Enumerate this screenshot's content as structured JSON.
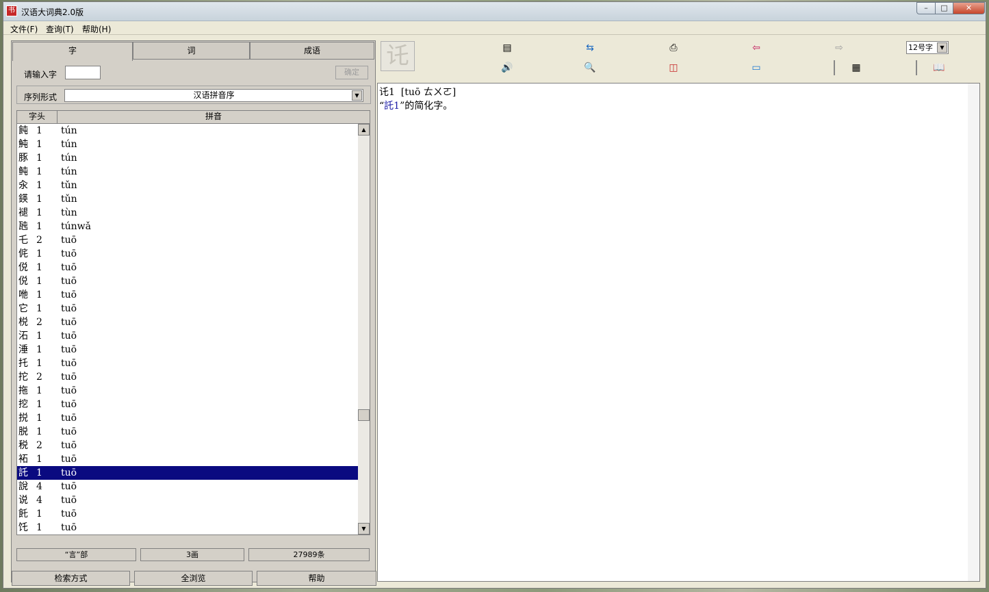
{
  "window": {
    "title": "汉语大词典2.0版",
    "app_icon": "书"
  },
  "window_buttons": {
    "minimize": "–",
    "maximize": "□",
    "close": "✕"
  },
  "menu": {
    "file": "文件(F)",
    "query": "查询(T)",
    "help": "帮助(H)"
  },
  "tabs": {
    "char": "字",
    "word": "词",
    "idiom": "成语"
  },
  "input": {
    "label": "请输入字",
    "value": "",
    "confirm": "确定"
  },
  "order": {
    "label": "序列形式",
    "value": "汉语拼音序",
    "arrow": "▼"
  },
  "list": {
    "headers": {
      "char": "字头",
      "pinyin": "拼音"
    },
    "rows": [
      {
        "c": "飩",
        "n": "1",
        "p": "tún"
      },
      {
        "c": "魨",
        "n": "1",
        "p": "tún"
      },
      {
        "c": "豚",
        "n": "1",
        "p": "tún"
      },
      {
        "c": "鲀",
        "n": "1",
        "p": "tún"
      },
      {
        "c": "汆",
        "n": "1",
        "p": "tǔn"
      },
      {
        "c": "鍈",
        "n": "1",
        "p": "tǔn"
      },
      {
        "c": "褪",
        "n": "1",
        "p": "tùn"
      },
      {
        "c": "瓲",
        "n": "1",
        "p": "túnwǎ"
      },
      {
        "c": "乇",
        "n": "2",
        "p": "tuō"
      },
      {
        "c": "侂",
        "n": "1",
        "p": "tuō"
      },
      {
        "c": "侻",
        "n": "1",
        "p": "tuō"
      },
      {
        "c": "侻",
        "n": "1",
        "p": "tuō"
      },
      {
        "c": "咃",
        "n": "1",
        "p": "tuō"
      },
      {
        "c": "它",
        "n": "1",
        "p": "tuō"
      },
      {
        "c": "棁",
        "n": "2",
        "p": "tuō"
      },
      {
        "c": "沰",
        "n": "1",
        "p": "tuō"
      },
      {
        "c": "涶",
        "n": "1",
        "p": "tuō"
      },
      {
        "c": "托",
        "n": "1",
        "p": "tuō"
      },
      {
        "c": "拕",
        "n": "2",
        "p": "tuō"
      },
      {
        "c": "拖",
        "n": "1",
        "p": "tuō"
      },
      {
        "c": "挖",
        "n": "1",
        "p": "tuō"
      },
      {
        "c": "捝",
        "n": "1",
        "p": "tuō"
      },
      {
        "c": "脱",
        "n": "1",
        "p": "tuō"
      },
      {
        "c": "税",
        "n": "2",
        "p": "tuō"
      },
      {
        "c": "袥",
        "n": "1",
        "p": "tuō"
      },
      {
        "c": "託",
        "n": "1",
        "p": "tuō",
        "selected": true
      },
      {
        "c": "說",
        "n": "4",
        "p": "tuō"
      },
      {
        "c": "说",
        "n": "4",
        "p": "tuō"
      },
      {
        "c": "飥",
        "n": "1",
        "p": "tuō"
      },
      {
        "c": "饦",
        "n": "1",
        "p": "tuō"
      }
    ]
  },
  "scroll_arrows": {
    "up": "▲",
    "down": "▼"
  },
  "status": {
    "radical": "“言”部",
    "strokes": "3画",
    "count": "27989条"
  },
  "bottom_buttons": {
    "search_mode": "检索方式",
    "browse": "全浏览",
    "help": "帮助"
  },
  "preview_char": "讬",
  "font_size": {
    "value": "12号字",
    "arrow": "▼"
  },
  "toolbar_icons": {
    "document": "▤",
    "copy": "⇆",
    "print": "⎙",
    "back": "⇦",
    "forward": "⇨",
    "speaker": "🔊",
    "magnifier": "🔍",
    "link": "◫",
    "keyboard": "▭",
    "layout": "▦",
    "book": "📖"
  },
  "colors": {
    "selection": "#0a0a80",
    "link": "#1a1aa6",
    "back_arrow": "#c2185b",
    "forward_arrow": "#9e9e9e"
  },
  "detail": {
    "line1": "讬1  [tuō ㄊㄨㄛ]",
    "line2_prefix": "“",
    "line2_link": "託1",
    "line2_suffix": "”的简化字。"
  }
}
